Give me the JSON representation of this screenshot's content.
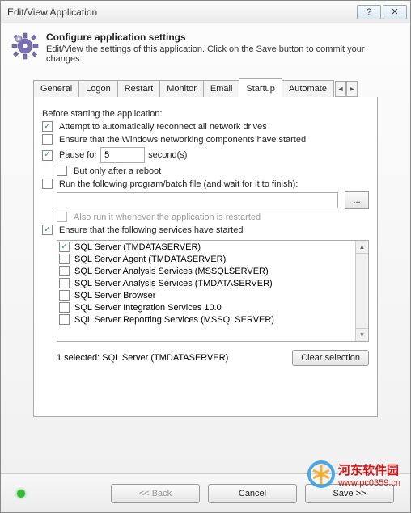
{
  "window": {
    "title": "Edit/View Application"
  },
  "header": {
    "title": "Configure application settings",
    "subtitle": "Edit/View the settings of this application. Click on the Save button to commit your changes."
  },
  "tabs": {
    "items": [
      "General",
      "Logon",
      "Restart",
      "Monitor",
      "Email",
      "Startup",
      "Automate"
    ],
    "active": "Startup"
  },
  "startup": {
    "intro": "Before starting the application:",
    "reconnect_label": "Attempt to automatically reconnect all network drives",
    "reconnect_checked": true,
    "winnet_label": "Ensure that the Windows networking components have started",
    "winnet_checked": false,
    "pause_label": "Pause for",
    "pause_checked": true,
    "pause_value": "5",
    "pause_suffix": "second(s)",
    "reboot_label": "But only after a reboot",
    "reboot_checked": false,
    "runprog_label": "Run the following program/batch file (and wait for it to finish):",
    "runprog_checked": false,
    "runprog_path": "",
    "browse_label": "...",
    "alsorun_label": "Also run it whenever the application is restarted",
    "alsorun_checked": false,
    "services_label": "Ensure that the following services have started",
    "services_checked": true,
    "services": [
      {
        "label": "SQL Server (TMDATASERVER)",
        "checked": true
      },
      {
        "label": "SQL Server Agent (TMDATASERVER)",
        "checked": false
      },
      {
        "label": "SQL Server Analysis Services (MSSQLSERVER)",
        "checked": false
      },
      {
        "label": "SQL Server Analysis Services (TMDATASERVER)",
        "checked": false
      },
      {
        "label": "SQL Server Browser",
        "checked": false
      },
      {
        "label": "SQL Server Integration Services 10.0",
        "checked": false
      },
      {
        "label": "SQL Server Reporting Services (MSSQLSERVER)",
        "checked": false
      }
    ],
    "selected_text": "1 selected: SQL Server (TMDATASERVER)",
    "clear_label": "Clear selection"
  },
  "footer": {
    "back": "<< Back",
    "cancel": "Cancel",
    "save": "Save >>"
  },
  "watermark": {
    "cn": "河东软件园",
    "url": "www.pc0359.cn"
  }
}
